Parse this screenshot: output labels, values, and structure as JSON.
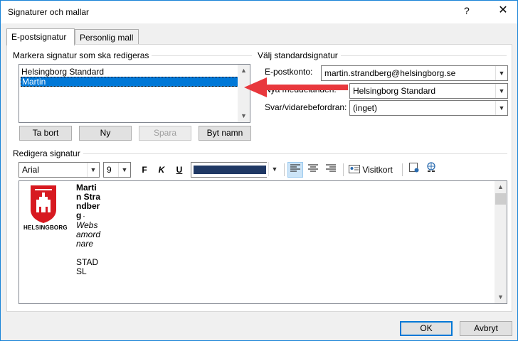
{
  "window": {
    "title": "Signaturer och mallar",
    "help": "?",
    "close": "✕"
  },
  "tabs": [
    {
      "label": "E-postsignatur",
      "active": true
    },
    {
      "label": "Personlig mall",
      "active": false
    }
  ],
  "edit_group": {
    "label": "Markera signatur som ska redigeras",
    "signatures": [
      "Helsingborg Standard",
      "Martin"
    ],
    "selected": "Martin",
    "buttons": {
      "delete": "Ta bort",
      "new": "Ny",
      "save": "Spara",
      "rename": "Byt namn"
    }
  },
  "default_group": {
    "label": "Välj standardsignatur",
    "account_label": "E-postkonto:",
    "account_value": "martin.strandberg@helsingborg.se",
    "new_messages_label": "Nya meddelanden:",
    "new_messages_value": "Helsingborg Standard",
    "replies_label": "Svar/vidarebefordran:",
    "replies_value": "(inget)"
  },
  "editor_group": {
    "label": "Redigera signatur",
    "font": "Arial",
    "size": "9",
    "bold": "F",
    "italic": "K",
    "underline": "U",
    "color": "#1f3864",
    "business_card": "Visitkort",
    "signature_lines": {
      "name": "Martin Strandberg",
      "dash": " -",
      "title": "Websamordnare",
      "dept": "STADSL"
    },
    "logo_text": "HELSINGBORG"
  },
  "footer": {
    "ok": "OK",
    "cancel": "Avbryt"
  },
  "colors": {
    "accent": "#0078d7",
    "arrow": "#e8383d",
    "logo_red": "#d71920"
  }
}
